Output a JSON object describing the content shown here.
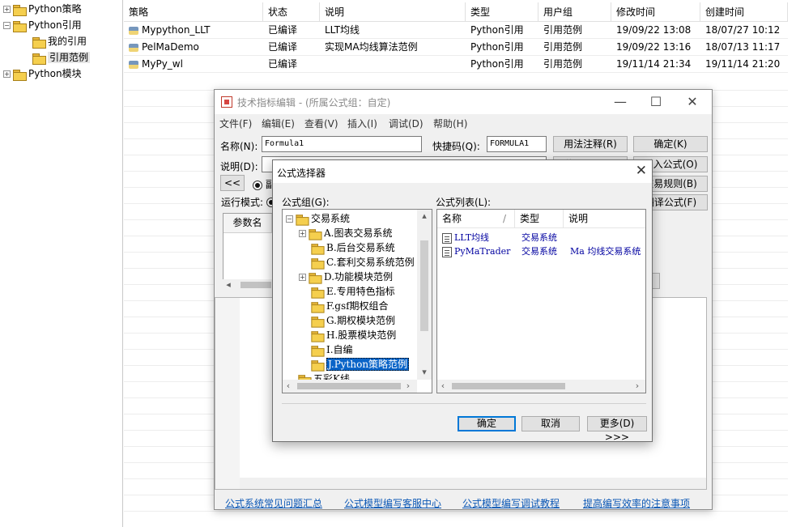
{
  "tree": {
    "items": [
      {
        "label": "Python策略",
        "expander": "+"
      },
      {
        "label": "Python引用",
        "expander": "−"
      },
      {
        "label": "我的引用",
        "expander": ""
      },
      {
        "label": "引用范例",
        "expander": ""
      },
      {
        "label": "Python模块",
        "expander": "+"
      }
    ]
  },
  "list": {
    "columns": [
      "策略",
      "状态",
      "说明",
      "类型",
      "用户组",
      "修改时间",
      "创建时间"
    ],
    "rows": [
      {
        "name": "Mypython_LLT",
        "status": "已编译",
        "desc": "LLT均线",
        "type": "Python引用",
        "group": "引用范例",
        "modified": "19/09/22 13:08",
        "created": "18/07/27 10:12"
      },
      {
        "name": "PelMaDemo",
        "status": "已编译",
        "desc": "实现MA均线算法范例",
        "type": "Python引用",
        "group": "引用范例",
        "modified": "19/09/22 13:16",
        "created": "18/07/13 11:17"
      },
      {
        "name": "MyPy_wl",
        "status": "已编译",
        "desc": "",
        "type": "Python引用",
        "group": "引用范例",
        "modified": "19/11/14 21:34",
        "created": "19/11/14 21:20"
      }
    ]
  },
  "editor": {
    "title": "技术指标编辑 - (所属公式组：自定)",
    "window_controls": {
      "minimize": "—",
      "maximize": "☐",
      "close": "✕"
    },
    "menu": [
      "文件(F)",
      "编辑(E)",
      "查看(V)",
      "插入(I)",
      "调试(D)",
      "帮助(H)"
    ],
    "name_label": "名称(N):",
    "name_value": "Formula1",
    "shortcut_label": "快捷码(Q):",
    "shortcut_value": "FORMULA1",
    "desc_label": "说明(D):",
    "buttons": {
      "usage_note": "用法注释(R)",
      "ok": "确定(K)",
      "usage_period": "使用周期(P)",
      "import": "引入公式(O)",
      "back": "<<",
      "trade_rules": "交易规则(B)",
      "translate": "翻译公式(F)"
    },
    "radio_partial": "副",
    "run_mode_label": "运行模式:",
    "param_header": "参数名",
    "footer_links": [
      "公式系统常见问题汇总",
      "公式模型编写客服中心",
      "公式模型编写调试教程",
      "提高编写效率的注意事项"
    ]
  },
  "dialog": {
    "title": "公式选择器",
    "close": "✕",
    "group_label": "公式组(G):",
    "list_label": "公式列表(L):",
    "groups": [
      {
        "label": "交易系统",
        "expander": "−",
        "depth": 0
      },
      {
        "label": "A.图表交易系统",
        "expander": "+",
        "depth": 1
      },
      {
        "label": "B.后台交易系统",
        "expander": "",
        "depth": 1
      },
      {
        "label": "C.套利交易系统范例",
        "expander": "",
        "depth": 1
      },
      {
        "label": "D.功能模块范例",
        "expander": "+",
        "depth": 1
      },
      {
        "label": "E.专用特色指标",
        "expander": "",
        "depth": 1
      },
      {
        "label": "F.gsf期权组合",
        "expander": "",
        "depth": 1
      },
      {
        "label": "G.期权模块范例",
        "expander": "",
        "depth": 1
      },
      {
        "label": "H.股票模块范例",
        "expander": "",
        "depth": 1
      },
      {
        "label": "I.自编",
        "expander": "",
        "depth": 1
      },
      {
        "label": "J.Python策略范例",
        "expander": "",
        "depth": 1,
        "selected": true
      },
      {
        "label": "五彩K线",
        "expander": "",
        "depth": 0
      }
    ],
    "list_columns": [
      "名称",
      "/",
      "类型",
      "说明"
    ],
    "formulas": [
      {
        "name": "LLT均线",
        "type": "交易系统",
        "desc": ""
      },
      {
        "name": "PyMaTrader",
        "type": "交易系统",
        "desc": "Ma 均线交易系统"
      }
    ],
    "buttons": {
      "ok": "确定",
      "cancel": "取消",
      "more": "更多(D) >>>"
    }
  }
}
